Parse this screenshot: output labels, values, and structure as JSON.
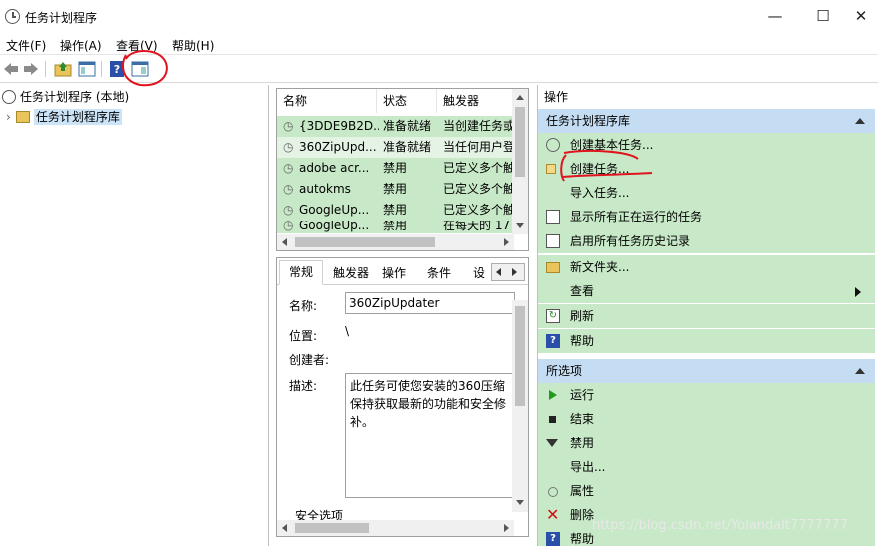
{
  "window": {
    "title": "任务计划程序",
    "min": "—",
    "max": "☐",
    "close": "✕"
  },
  "menu": [
    "文件(F)",
    "操作(A)",
    "查看(V)",
    "帮助(H)"
  ],
  "tree": {
    "root": "任务计划程序 (本地)",
    "library": "任务计划程序库"
  },
  "list": {
    "headers": [
      "名称",
      "状态",
      "触发器"
    ],
    "rows": [
      {
        "name": "{3DDE9B2D...",
        "status": "准备就绪",
        "trigger": "当创建任务或"
      },
      {
        "name": "360ZipUpd...",
        "status": "准备就绪",
        "trigger": "当任何用户登"
      },
      {
        "name": "adobe acr...",
        "status": "禁用",
        "trigger": "已定义多个触"
      },
      {
        "name": "autokms",
        "status": "禁用",
        "trigger": "已定义多个触"
      },
      {
        "name": "GoogleUp...",
        "status": "禁用",
        "trigger": "已定义多个触"
      },
      {
        "name": "GoogleUp...",
        "status": "禁用",
        "trigger": "在每天的 17"
      }
    ]
  },
  "detail": {
    "tabs": [
      "常规",
      "触发器",
      "操作",
      "条件",
      "设"
    ],
    "name_label": "名称:",
    "name_value": "360ZipUpdater",
    "location_label": "位置:",
    "location_value": "\\",
    "author_label": "创建者:",
    "desc_label": "描述:",
    "desc_value": "此任务可使您安装的360压缩保持获取最新的功能和安全修补。",
    "security_label": "安全选项"
  },
  "actions": {
    "header": "操作",
    "section1": "任务计划程序库",
    "items1": [
      "创建基本任务...",
      "创建任务...",
      "导入任务...",
      "显示所有正在运行的任务",
      "启用所有任务历史记录",
      "新文件夹...",
      "查看",
      "刷新",
      "帮助"
    ],
    "section2": "所选项",
    "items2": [
      "运行",
      "结束",
      "禁用",
      "导出...",
      "属性",
      "删除",
      "帮助"
    ]
  },
  "watermark": "https://blog.csdn.net/Yolandalt7777777"
}
